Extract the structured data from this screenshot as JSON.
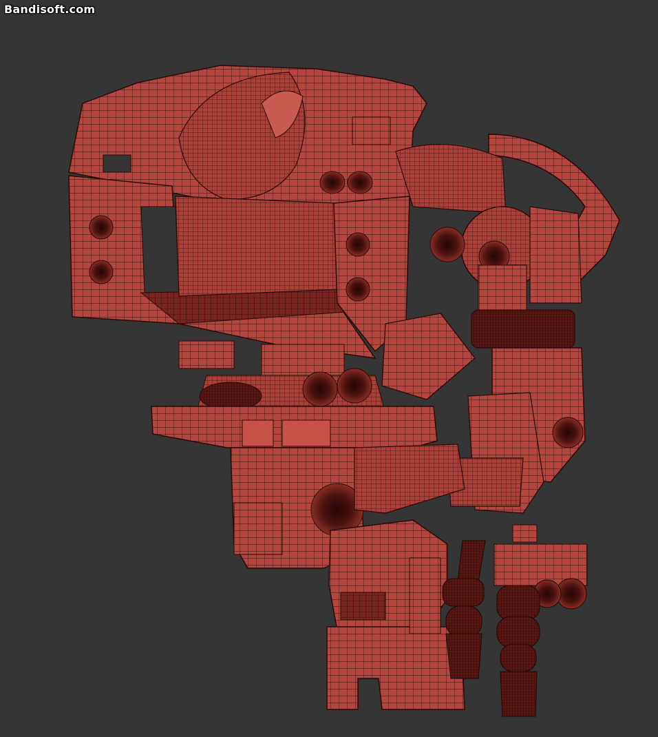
{
  "watermark": {
    "text": "Bandisoft.com"
  },
  "viewport": {
    "background_color": "#353535",
    "mesh_color": "#b5463f",
    "wire_color": "#3a0e0c",
    "shadow_color": "#7a2320",
    "subject": "robot-mech-wireframe-mesh"
  }
}
